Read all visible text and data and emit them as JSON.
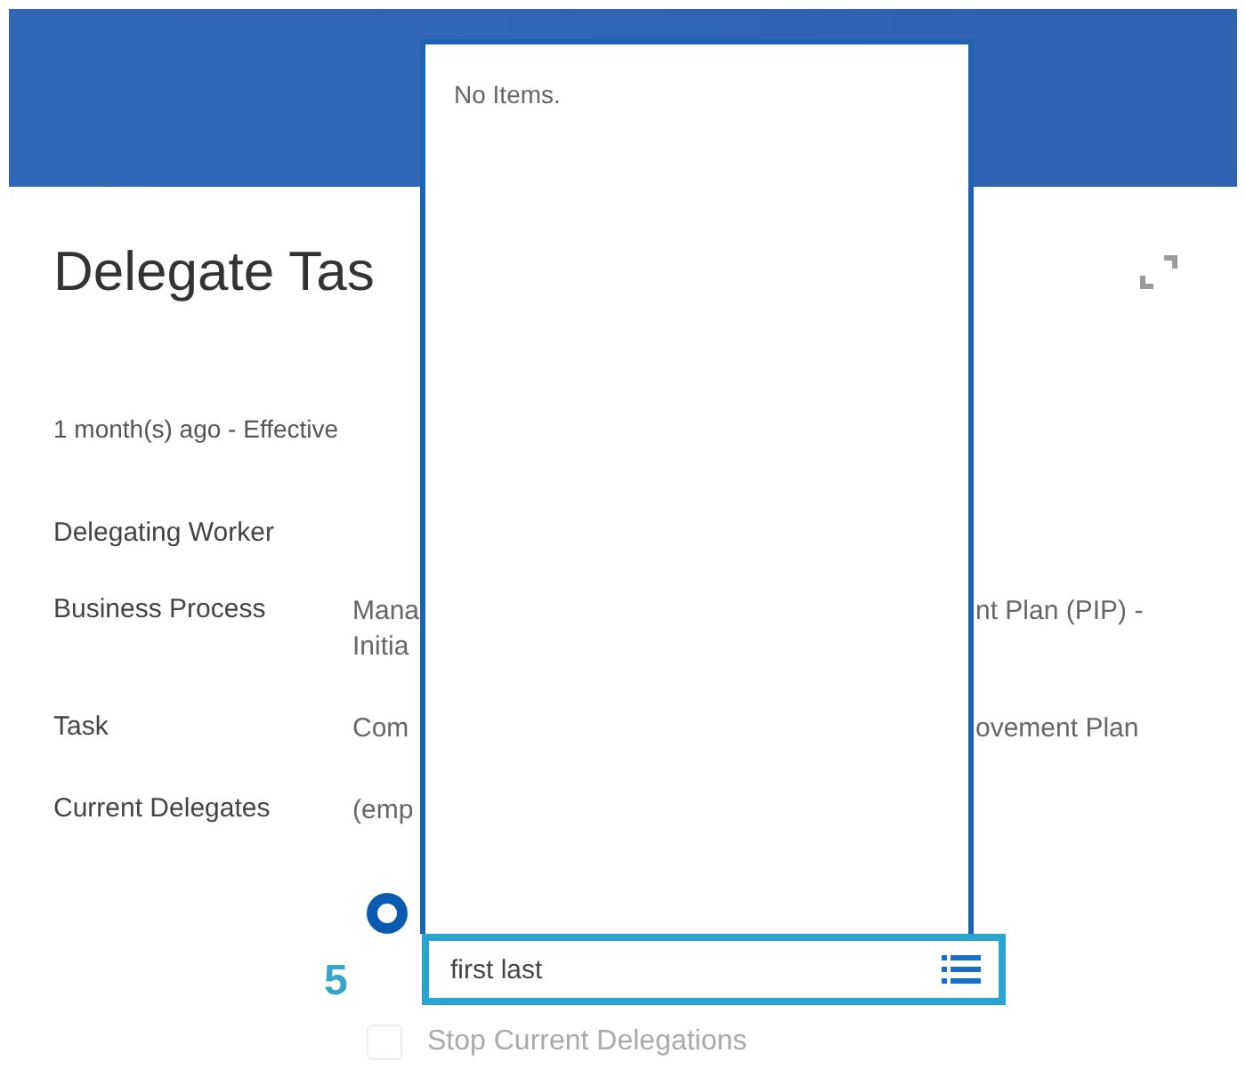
{
  "page_title": "Delegate Tas",
  "timestamp": "1 month(s) ago -  Effective",
  "fields": [
    {
      "label": "Delegating Worker"
    },
    {
      "label": "Business Process",
      "value_start": [
        "Mana",
        "Initia"
      ],
      "value_end": [
        "nt Plan (PIP) -"
      ]
    },
    {
      "label": "Task",
      "value_start": [
        "Com"
      ],
      "value_end": [
        "ovement Plan"
      ]
    },
    {
      "label": "Current Delegates",
      "value_start": [
        "(emp"
      ]
    }
  ],
  "radio": {
    "selected": true
  },
  "step_number": "5",
  "prompt_popup": {
    "empty_message": "No Items."
  },
  "search_field": {
    "value": "first last"
  },
  "checkbox": {
    "label": "Stop Current Delegations",
    "checked": false
  }
}
